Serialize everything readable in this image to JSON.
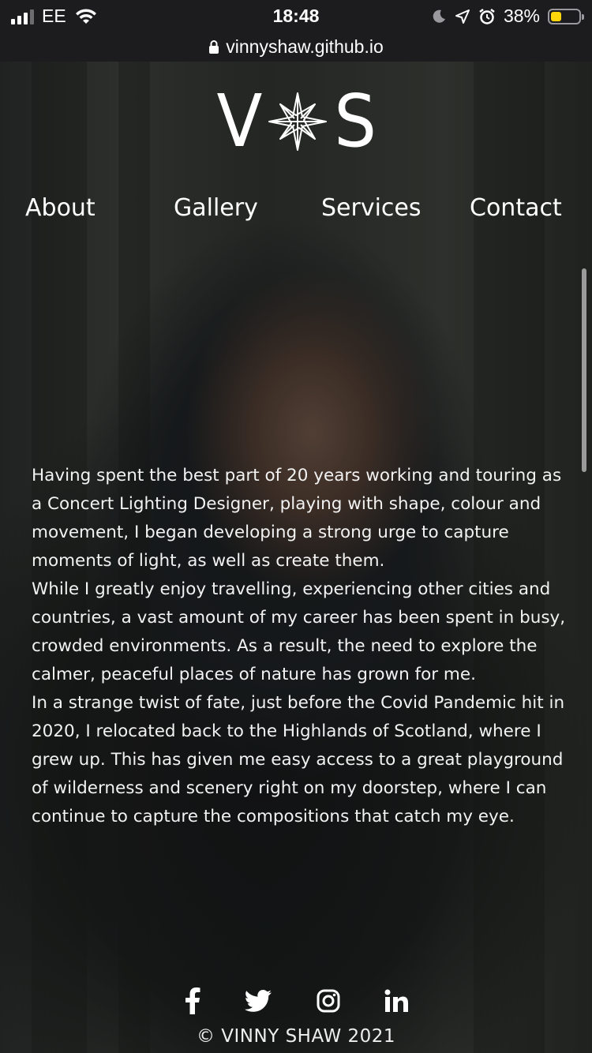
{
  "status_bar": {
    "carrier": "EE",
    "time": "18:48",
    "battery_percent": "38%",
    "battery_level": 0.38
  },
  "browser": {
    "url": "vinnyshaw.github.io"
  },
  "logo": {
    "left": "V",
    "right": "S"
  },
  "nav": {
    "items": [
      "About",
      "Gallery",
      "Services",
      "Contact"
    ]
  },
  "about": {
    "paragraphs": [
      "Having spent the best part of 20 years working and touring as a Concert Lighting Designer, playing with shape, colour and movement, I began developing a strong urge to capture moments of light, as well as create them.",
      "While I greatly enjoy travelling, experiencing other cities and countries, a vast amount of my career has been spent in busy, crowded environments. As a result, the need to explore the calmer, peaceful places of nature has grown for me.",
      "In a strange twist of fate, just before the Covid Pandemic hit in 2020, I relocated back to the Highlands of Scotland, where I grew up. This has given me easy access to a great playground of wilderness and scenery right on my doorstep, where I can continue to capture the compositions that catch my eye."
    ]
  },
  "social": {
    "icons": [
      "facebook-icon",
      "twitter-icon",
      "instagram-icon",
      "linkedin-icon"
    ]
  },
  "footer": {
    "copyright": "© VINNY SHAW 2021"
  }
}
